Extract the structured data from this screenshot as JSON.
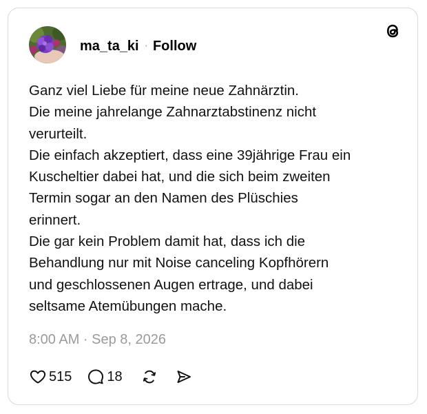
{
  "post": {
    "author": {
      "username": "ma_ta_ki",
      "separator": "·",
      "follow_label": "Follow",
      "avatar_icon": "hydrangea-photo-avatar"
    },
    "text_lines": [
      "Ganz viel Liebe für meine neue Zahnärztin.",
      "Die meine jahrelange Zahnarztabstinenz nicht",
      "verurteilt.",
      "Die einfach akzeptiert, dass eine 39jährige Frau ein",
      "Kuscheltier dabei hat, und die sich beim zweiten",
      "Termin sogar an den Namen des Plüschies",
      "erinnert.",
      "Die gar kein Problem damit hat, dass ich die",
      "Behandlung nur mit Noise canceling Kopfhörern",
      "und geschlossenen Augen ertrage, und dabei",
      "seltsame Atemübungen mache."
    ],
    "timestamp": "8:00 AM · Sep 8, 2026",
    "likes": "515",
    "replies": "18",
    "icons": {
      "brand": "threads-logo-icon",
      "like": "heart-icon",
      "reply": "speech-bubble-icon",
      "repost": "repost-icon",
      "share": "send-icon"
    },
    "colors": {
      "text": "#111111",
      "muted": "#9a9a9a",
      "border": "#d9d9d9"
    }
  }
}
